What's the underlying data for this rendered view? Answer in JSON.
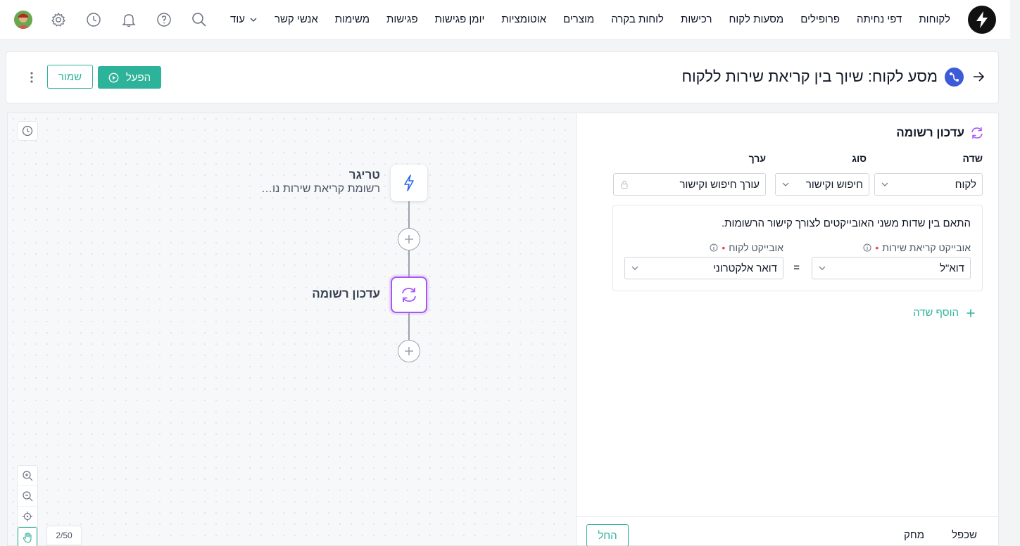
{
  "nav": {
    "items": [
      "לקוחות",
      "דפי נחיתה",
      "פרופילים",
      "מסעות לקוח",
      "רכישות",
      "לוחות בקרה",
      "מוצרים",
      "אוטומציות",
      "יומן פגישות",
      "פגישות",
      "משימות",
      "אנשי קשר"
    ],
    "more_label": "עוד"
  },
  "header": {
    "title": "מסע לקוח: שיוך בין קריאת שירות ללקוח",
    "activate_label": "הפעל",
    "save_label": "שמור"
  },
  "canvas": {
    "trigger_title": "טריגר",
    "trigger_subtitle": "רשומת קריאת שירות נוצרה",
    "update_title": "עדכון רשומה",
    "page_count": "2/50"
  },
  "panel": {
    "title": "עדכון רשומה",
    "columns": {
      "field": "שדה",
      "type": "סוג",
      "value": "ערך"
    },
    "row": {
      "field": "לקוח",
      "type": "חיפוש וקישור",
      "value": "עורך חיפוש וקישור"
    },
    "match": {
      "description": "התאם בין שדות משני האובייקטים לצורך קישור הרשומות.",
      "left_label": "אובייקט קריאת שירות",
      "left_value": "דוא\"ל",
      "right_label": "אובייקט לקוח",
      "right_value": "דואר אלקטרוני",
      "equals": "="
    },
    "add_field_label": "הוסף שדה",
    "footer": {
      "duplicate": "שכפל",
      "delete": "מחק",
      "start": "החל"
    }
  },
  "colors": {
    "accent": "#2db39a",
    "selected_node": "#a855f7",
    "journey_icon": "#3b5bd8"
  }
}
